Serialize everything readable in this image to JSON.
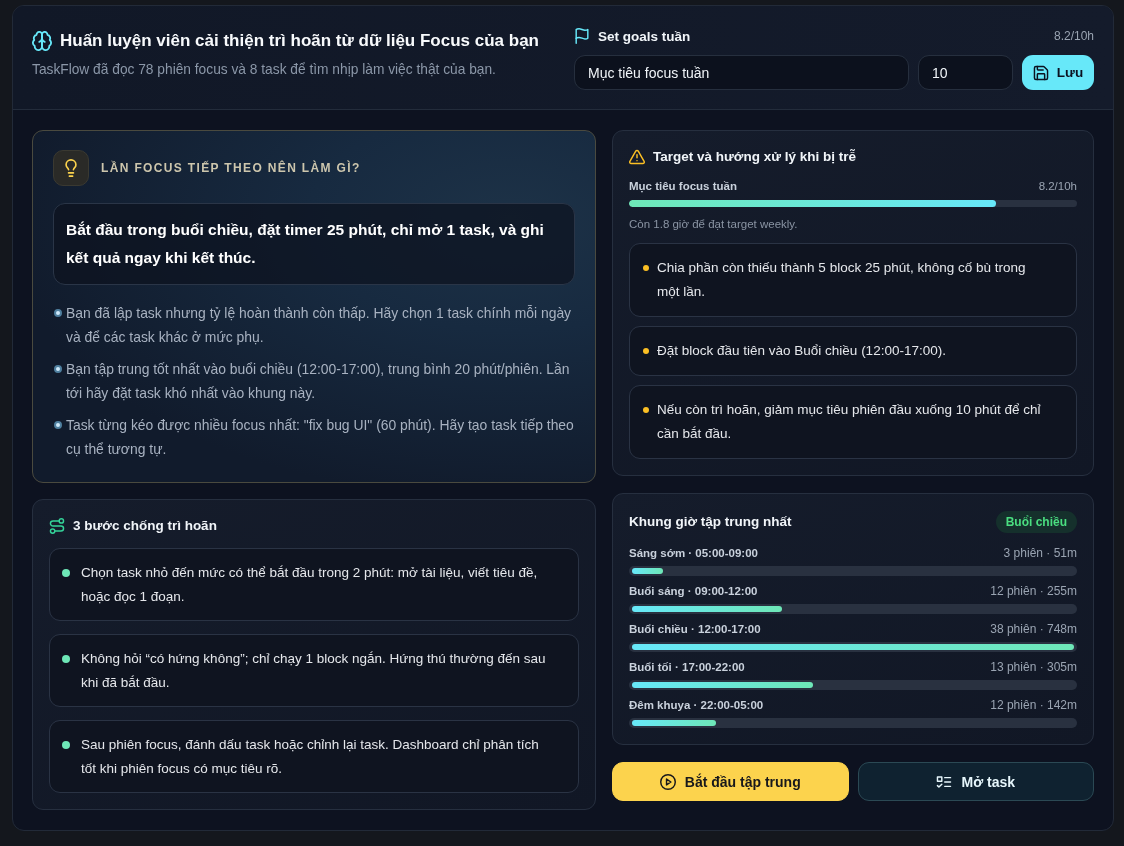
{
  "header": {
    "title": "Huấn luyện viên cải thiện trì hoãn từ dữ liệu Focus của bạn",
    "subtitle": "TaskFlow đã đọc 78 phiên focus và 8 task để tìm nhịp làm việc thật của bạn."
  },
  "goal_form": {
    "title": "Set goals tuần",
    "progress": "8.2/10h",
    "goal_name": {
      "value": "Mục tiêu focus tuần"
    },
    "goal_hours": {
      "value": "10"
    },
    "save_button": "Lưu"
  },
  "next_focus": {
    "heading": "LẦN FOCUS TIẾP THEO NÊN LÀM GÌ?",
    "recommendation": "Bắt đầu trong buổi chiều, đặt timer 25 phút, chỉ mở 1 task, và ghi kết quả ngay khi kết thúc.",
    "insights": [
      "Bạn đã lập task nhưng tỷ lệ hoàn thành còn thấp. Hãy chọn 1 task chính mỗi ngày và để các task khác ở mức phụ.",
      "Bạn tập trung tốt nhất vào buổi chiều (12:00-17:00), trung bình 20 phút/phiên. Lần tới hãy đặt task khó nhất vào khung này.",
      "Task từng kéo được nhiều focus nhất: \"fix bug UI\" (60 phút). Hãy tạo task tiếp theo cụ thể tương tự."
    ]
  },
  "steps": {
    "title": "3 bước chống trì hoãn",
    "items": [
      "Chọn task nhỏ đến mức có thể bắt đầu trong 2 phút: mở tài liệu, viết tiêu đề, hoặc đọc 1 đoạn.",
      "Không hỏi “có hứng không”; chỉ chạy 1 block ngắn. Hứng thú thường đến sau khi đã bắt đầu.",
      "Sau phiên focus, đánh dấu task hoặc chỉnh lại task. Dashboard chỉ phân tích tốt khi phiên focus có mục tiêu rõ."
    ]
  },
  "target": {
    "title": "Target và hướng xử lý khi bị trễ",
    "goal_label": "Mục tiêu focus tuần",
    "goal_reading": "8.2/10h",
    "level": 0.82,
    "remaining": "Còn 1.8 giờ để đạt target weekly.",
    "actions": [
      "Chia phần còn thiếu thành 5 block 25 phút, không cố bù trong một lần.",
      "Đặt block đầu tiên vào Buổi chiều (12:00-17:00).",
      "Nếu còn trì hoãn, giảm mục tiêu phiên đầu xuống 10 phút để chỉ cần bắt đầu."
    ]
  },
  "focus_windows": {
    "title": "Khung giờ tập trung nhất",
    "badge": "Buổi chiều",
    "rows": [
      {
        "label": "Sáng sớm · 05:00-09:00",
        "reading": "3 phiên · 51m",
        "level": 0.07
      },
      {
        "label": "Buổi sáng · 09:00-12:00",
        "reading": "12 phiên · 255m",
        "level": 0.34
      },
      {
        "label": "Buổi chiều · 12:00-17:00",
        "reading": "38 phiên · 748m",
        "level": 1
      },
      {
        "label": "Buổi tối · 17:00-22:00",
        "reading": "13 phiên · 305m",
        "level": 0.41
      },
      {
        "label": "Đêm khuya · 22:00-05:00",
        "reading": "12 phiên · 142m",
        "level": 0.19
      }
    ]
  },
  "buttons": [
    {
      "label": "Bắt đầu tập trung",
      "kind": "primary"
    },
    {
      "label": "Mở task",
      "kind": "secondary"
    }
  ]
}
